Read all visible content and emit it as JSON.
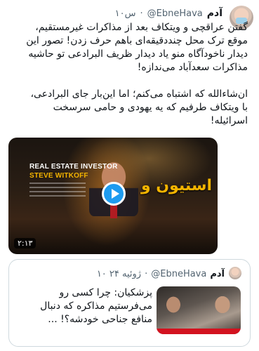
{
  "tweet": {
    "display_name": "آدم",
    "handle": "@EbneHava",
    "separator": "·",
    "time": "۱۰س",
    "paragraphs": [
      "گفتن عراقچی و ویتکاف بعد از مذاکرات غیرمستقیم، موقع ترک محل چنددقیقه‌ای باهم حرف زدن! تصور این دیدار ناخودآگاه منو یاد دیدار ظریف البرادعی تو حاشیه مذاکرات سعدآباد می‌ندازه!",
      "ان‌شاءالله که اشتباه می‌کنم؛ اما این‌بار جای البرادعی، با ویتکاف طرفیم که یه یهودی و حامی سرسخت اسرائیله!"
    ]
  },
  "video": {
    "lower_third_line1": "REAL ESTATE INVESTOR",
    "lower_third_line2": "STEVE WITKOFF",
    "overlay_title": "استیون و",
    "duration": "۲:۱۳",
    "play_icon": "play-icon"
  },
  "quoted_tweet": {
    "display_name": "آدم",
    "handle": "@EbneHava",
    "separator": "·",
    "date": "۱۰ ژوئیه ۲۴",
    "text": "پزشکیان: چرا کسی رو می‌فرستیم مذاکره که دنبال منافع جناحی خودشه؟! ..."
  },
  "colors": {
    "text": "#0f1419",
    "secondary": "#536471",
    "accent": "#1d9bf0",
    "border": "#cfd9de",
    "video_title": "#f4b400"
  }
}
